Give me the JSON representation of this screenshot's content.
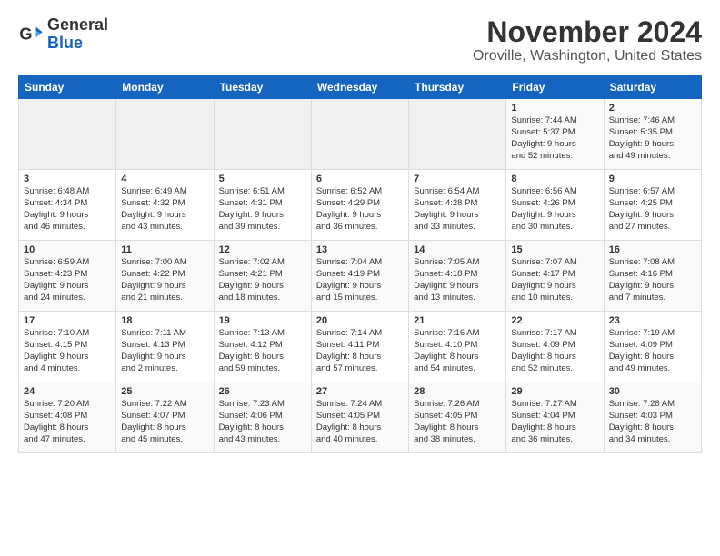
{
  "logo": {
    "line1": "General",
    "line2": "Blue"
  },
  "title": "November 2024",
  "subtitle": "Oroville, Washington, United States",
  "days_of_week": [
    "Sunday",
    "Monday",
    "Tuesday",
    "Wednesday",
    "Thursday",
    "Friday",
    "Saturday"
  ],
  "weeks": [
    [
      {
        "day": "",
        "info": ""
      },
      {
        "day": "",
        "info": ""
      },
      {
        "day": "",
        "info": ""
      },
      {
        "day": "",
        "info": ""
      },
      {
        "day": "",
        "info": ""
      },
      {
        "day": "1",
        "info": "Sunrise: 7:44 AM\nSunset: 5:37 PM\nDaylight: 9 hours\nand 52 minutes."
      },
      {
        "day": "2",
        "info": "Sunrise: 7:46 AM\nSunset: 5:35 PM\nDaylight: 9 hours\nand 49 minutes."
      }
    ],
    [
      {
        "day": "3",
        "info": "Sunrise: 6:48 AM\nSunset: 4:34 PM\nDaylight: 9 hours\nand 46 minutes."
      },
      {
        "day": "4",
        "info": "Sunrise: 6:49 AM\nSunset: 4:32 PM\nDaylight: 9 hours\nand 43 minutes."
      },
      {
        "day": "5",
        "info": "Sunrise: 6:51 AM\nSunset: 4:31 PM\nDaylight: 9 hours\nand 39 minutes."
      },
      {
        "day": "6",
        "info": "Sunrise: 6:52 AM\nSunset: 4:29 PM\nDaylight: 9 hours\nand 36 minutes."
      },
      {
        "day": "7",
        "info": "Sunrise: 6:54 AM\nSunset: 4:28 PM\nDaylight: 9 hours\nand 33 minutes."
      },
      {
        "day": "8",
        "info": "Sunrise: 6:56 AM\nSunset: 4:26 PM\nDaylight: 9 hours\nand 30 minutes."
      },
      {
        "day": "9",
        "info": "Sunrise: 6:57 AM\nSunset: 4:25 PM\nDaylight: 9 hours\nand 27 minutes."
      }
    ],
    [
      {
        "day": "10",
        "info": "Sunrise: 6:59 AM\nSunset: 4:23 PM\nDaylight: 9 hours\nand 24 minutes."
      },
      {
        "day": "11",
        "info": "Sunrise: 7:00 AM\nSunset: 4:22 PM\nDaylight: 9 hours\nand 21 minutes."
      },
      {
        "day": "12",
        "info": "Sunrise: 7:02 AM\nSunset: 4:21 PM\nDaylight: 9 hours\nand 18 minutes."
      },
      {
        "day": "13",
        "info": "Sunrise: 7:04 AM\nSunset: 4:19 PM\nDaylight: 9 hours\nand 15 minutes."
      },
      {
        "day": "14",
        "info": "Sunrise: 7:05 AM\nSunset: 4:18 PM\nDaylight: 9 hours\nand 13 minutes."
      },
      {
        "day": "15",
        "info": "Sunrise: 7:07 AM\nSunset: 4:17 PM\nDaylight: 9 hours\nand 10 minutes."
      },
      {
        "day": "16",
        "info": "Sunrise: 7:08 AM\nSunset: 4:16 PM\nDaylight: 9 hours\nand 7 minutes."
      }
    ],
    [
      {
        "day": "17",
        "info": "Sunrise: 7:10 AM\nSunset: 4:15 PM\nDaylight: 9 hours\nand 4 minutes."
      },
      {
        "day": "18",
        "info": "Sunrise: 7:11 AM\nSunset: 4:13 PM\nDaylight: 9 hours\nand 2 minutes."
      },
      {
        "day": "19",
        "info": "Sunrise: 7:13 AM\nSunset: 4:12 PM\nDaylight: 8 hours\nand 59 minutes."
      },
      {
        "day": "20",
        "info": "Sunrise: 7:14 AM\nSunset: 4:11 PM\nDaylight: 8 hours\nand 57 minutes."
      },
      {
        "day": "21",
        "info": "Sunrise: 7:16 AM\nSunset: 4:10 PM\nDaylight: 8 hours\nand 54 minutes."
      },
      {
        "day": "22",
        "info": "Sunrise: 7:17 AM\nSunset: 4:09 PM\nDaylight: 8 hours\nand 52 minutes."
      },
      {
        "day": "23",
        "info": "Sunrise: 7:19 AM\nSunset: 4:09 PM\nDaylight: 8 hours\nand 49 minutes."
      }
    ],
    [
      {
        "day": "24",
        "info": "Sunrise: 7:20 AM\nSunset: 4:08 PM\nDaylight: 8 hours\nand 47 minutes."
      },
      {
        "day": "25",
        "info": "Sunrise: 7:22 AM\nSunset: 4:07 PM\nDaylight: 8 hours\nand 45 minutes."
      },
      {
        "day": "26",
        "info": "Sunrise: 7:23 AM\nSunset: 4:06 PM\nDaylight: 8 hours\nand 43 minutes."
      },
      {
        "day": "27",
        "info": "Sunrise: 7:24 AM\nSunset: 4:05 PM\nDaylight: 8 hours\nand 40 minutes."
      },
      {
        "day": "28",
        "info": "Sunrise: 7:26 AM\nSunset: 4:05 PM\nDaylight: 8 hours\nand 38 minutes."
      },
      {
        "day": "29",
        "info": "Sunrise: 7:27 AM\nSunset: 4:04 PM\nDaylight: 8 hours\nand 36 minutes."
      },
      {
        "day": "30",
        "info": "Sunrise: 7:28 AM\nSunset: 4:03 PM\nDaylight: 8 hours\nand 34 minutes."
      }
    ]
  ]
}
